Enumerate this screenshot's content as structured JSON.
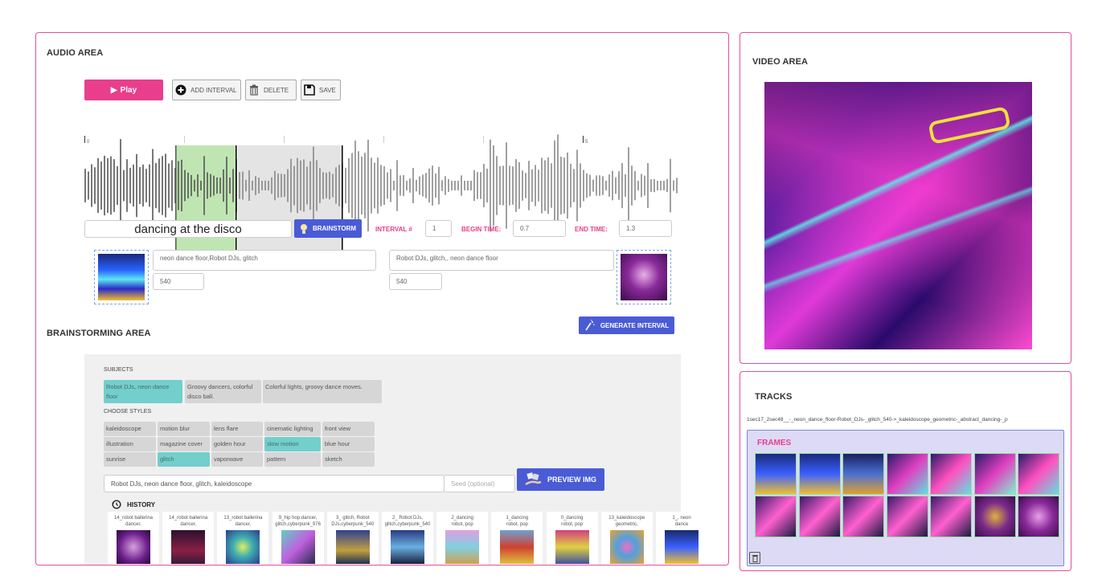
{
  "audio_area": {
    "title": "AUDIO AREA",
    "toolbar": {
      "play_label": "Play",
      "add_interval_label": "ADD INTERVAL",
      "delete_label": "DELETE",
      "save_label": "SAVE"
    },
    "timeline": {
      "tick_labels": [
        "0",
        "5"
      ],
      "selected_interval": {
        "begin": 0.7,
        "end": 1.3
      },
      "colors": {
        "selection": "#bfe6b2",
        "region": "#e4e4e4",
        "wave": "#888888"
      }
    },
    "prompt_input": "dancing at the disco",
    "brainstorm_label": "BRAINSTORM",
    "interval_label": "INTERVAL #",
    "interval_value": "1",
    "begin_time_label": "BEGIN TIME:",
    "begin_time_value": "0.7",
    "end_time_label": "END TIME:",
    "end_time_value": "1.3",
    "start_prompt": "neon dance floor,Robot DJs, glitch",
    "start_seed": "540",
    "end_prompt": "Robot DJs, glitch,, neon dance floor",
    "end_seed": "540",
    "generate_label": "GENERATE INTERVAL"
  },
  "brainstorming": {
    "title": "BRAINSTORMING AREA",
    "subjects_label": "SUBJECTS",
    "subjects": [
      {
        "label": "Robot DJs, neon dance floor",
        "selected": true
      },
      {
        "label": "Groovy dancers, colorful disco ball.",
        "selected": false
      },
      {
        "label": "Colorful lights, groovy dance moves.",
        "selected": false
      }
    ],
    "styles_label": "CHOOSE STYLES",
    "styles": [
      {
        "label": "kaleidoscope",
        "selected": false
      },
      {
        "label": "motion blur",
        "selected": false
      },
      {
        "label": "lens flare",
        "selected": false
      },
      {
        "label": "cinematic lighting",
        "selected": false
      },
      {
        "label": "front view",
        "selected": false
      },
      {
        "label": "illustration",
        "selected": false
      },
      {
        "label": "magazine cover",
        "selected": false
      },
      {
        "label": "golden hour",
        "selected": false
      },
      {
        "label": "slow motion",
        "selected": true
      },
      {
        "label": "blue hour",
        "selected": false
      },
      {
        "label": "sunrise",
        "selected": false
      },
      {
        "label": "glitch",
        "selected": true
      },
      {
        "label": "vaporwave",
        "selected": false
      },
      {
        "label": "pattern",
        "selected": false
      },
      {
        "label": "sketch",
        "selected": false
      }
    ],
    "prompt_value": "Robot DJs, neon dance floor, glitch, kaleidoscope",
    "seed_placeholder": "Seed (optional)",
    "preview_label": "PREVIEW IMG",
    "history_label": "HISTORY",
    "history": [
      {
        "line1": "14_robot ballerina",
        "line2": "dancer,"
      },
      {
        "line1": "14_robot ballerina",
        "line2": "dancer,"
      },
      {
        "line1": "13_robot ballerina",
        "line2": "dancer,"
      },
      {
        "line1": "9_hip hop dancer,",
        "line2": "glitch,cyberpunk_976"
      },
      {
        "line1": "3_ glitch, Robot",
        "line2": "DJs,cyberpunk_540"
      },
      {
        "line1": "2_ Robot DJs,",
        "line2": "glitch,cyberpunk_540"
      },
      {
        "line1": "2_dancing",
        "line2": "robot, pop"
      },
      {
        "line1": "1_dancing",
        "line2": "robot, pop"
      },
      {
        "line1": "0_dancing",
        "line2": "robot, pop"
      },
      {
        "line1": "13_kaleidoscope",
        "line2": "geometric,"
      },
      {
        "line1": "1_, neon",
        "line2": "dance"
      }
    ]
  },
  "video_area": {
    "title": "VIDEO AREA"
  },
  "tracks": {
    "title": "TRACKS",
    "track_name": "1sec17_2sec48__-_neon_dance_floor-Robot_DJs-_glitch_540->_kaleidoscope_geometric-_abstract_dancing-_p",
    "frames_label": "FRAMES",
    "frame_count": 14
  },
  "colors": {
    "accent_pink": "#e83e8c",
    "button_blue": "#4a5bd6",
    "chip_selected": "#72cfcc",
    "frames_bg": "#dcdaf5"
  }
}
